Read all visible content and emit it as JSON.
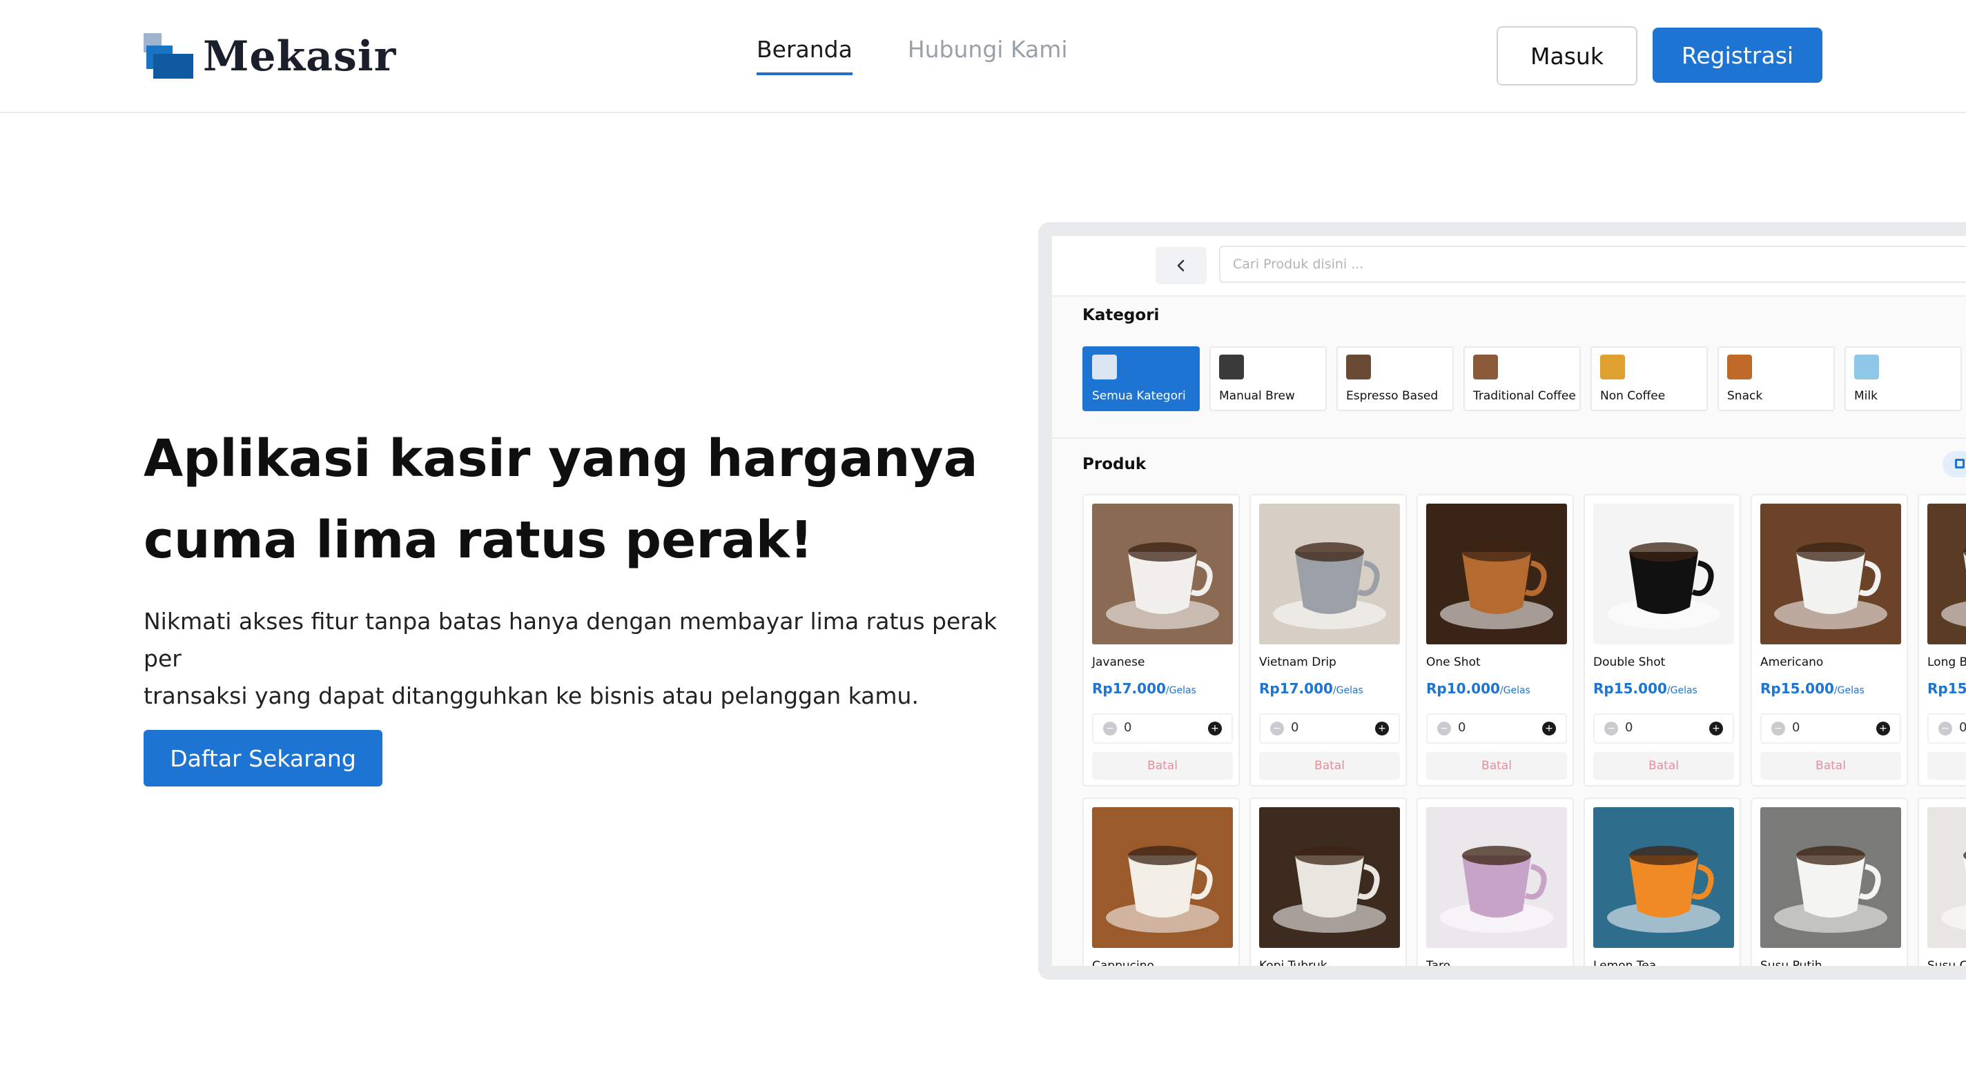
{
  "header": {
    "logo_text": "Mekasir",
    "nav": [
      {
        "label": "Beranda",
        "active": true
      },
      {
        "label": "Hubungi Kami",
        "active": false
      }
    ],
    "login_label": "Masuk",
    "register_label": "Registrasi"
  },
  "hero": {
    "title_line1": "Aplikasi kasir yang harganya",
    "title_line2": "cuma lima ratus perak!",
    "desc_line1": "Nikmati akses fitur tanpa batas hanya dengan membayar lima ratus perak per",
    "desc_line2": "transaksi yang dapat ditangguhkan ke bisnis atau pelanggan kamu.",
    "cta_label": "Daftar Sekarang"
  },
  "mock": {
    "back_icon": "chevron-left-icon",
    "search_placeholder": "Cari Produk disini ...",
    "kategori_label": "Kategori",
    "categories": [
      {
        "label": "Semua Kategori",
        "active": true,
        "color": "#dce6f3"
      },
      {
        "label": "Manual Brew",
        "active": false,
        "color": "#3a3a3a"
      },
      {
        "label": "Espresso Based",
        "active": false,
        "color": "#6b4a33"
      },
      {
        "label": "Traditional Coffee",
        "active": false,
        "color": "#8a5a3a"
      },
      {
        "label": "Non Coffee",
        "active": false,
        "color": "#e0a030"
      },
      {
        "label": "Snack",
        "active": false,
        "color": "#c06a2a"
      },
      {
        "label": "Milk",
        "active": false,
        "color": "#8fc7e6"
      }
    ],
    "produk_label": "Produk",
    "products": [
      {
        "name": "Javanese",
        "price": "Rp17.000",
        "unit": "/Gelas",
        "qty": "0",
        "batal": "Batal",
        "bg": "#8a6a52",
        "cup": "#f2f0ec"
      },
      {
        "name": "Vietnam Drip",
        "price": "Rp17.000",
        "unit": "/Gelas",
        "qty": "0",
        "batal": "Batal",
        "bg": "#d7cec6",
        "cup": "#9aa0a6"
      },
      {
        "name": "One Shot",
        "price": "Rp10.000",
        "unit": "/Gelas",
        "qty": "0",
        "batal": "Batal",
        "bg": "#3a2416",
        "cup": "#b56a30"
      },
      {
        "name": "Double Shot",
        "price": "Rp15.000",
        "unit": "/Gelas",
        "qty": "0",
        "batal": "Batal",
        "bg": "#f4f4f4",
        "cup": "#111111"
      },
      {
        "name": "Americano",
        "price": "Rp15.000",
        "unit": "/Gelas",
        "qty": "0",
        "batal": "Batal",
        "bg": "#6a4328",
        "cup": "#f2f2f0"
      },
      {
        "name": "Long B",
        "price": "Rp15.0",
        "unit": "",
        "qty": "0",
        "batal": "",
        "bg": "#5a3b24",
        "cup": "#e8e4de"
      },
      {
        "name": "Cappucino",
        "price": "",
        "unit": "",
        "qty": "",
        "batal": "",
        "bg": "#9a5a2c",
        "cup": "#f4efe6"
      },
      {
        "name": "Kopi Tubruk",
        "price": "",
        "unit": "",
        "qty": "",
        "batal": "",
        "bg": "#3d2b1f",
        "cup": "#e9e6e0"
      },
      {
        "name": "Taro",
        "price": "",
        "unit": "",
        "qty": "",
        "batal": "",
        "bg": "#ece7ea",
        "cup": "#c7a3c8"
      },
      {
        "name": "Lemon Tea",
        "price": "",
        "unit": "",
        "qty": "",
        "batal": "",
        "bg": "#2f6d8c",
        "cup": "#f08a24"
      },
      {
        "name": "Susu Putih",
        "price": "",
        "unit": "",
        "qty": "",
        "batal": "",
        "bg": "#7a7a78",
        "cup": "#f4f4f2"
      },
      {
        "name": "Susu C",
        "price": "",
        "unit": "",
        "qty": "",
        "batal": "",
        "bg": "#e8e6e2",
        "cup": "#f8f8f6"
      }
    ]
  },
  "colors": {
    "accent": "#1d74d2",
    "batal_text": "#e58f9b"
  }
}
